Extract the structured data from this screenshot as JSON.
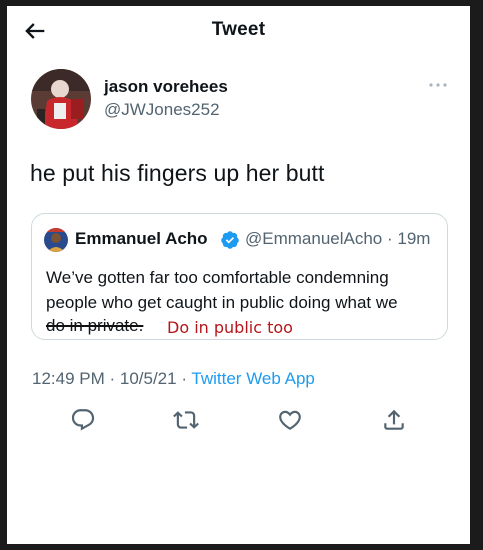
{
  "header": {
    "title": "Tweet",
    "back_icon": "arrow-left-icon"
  },
  "tweet": {
    "author_name": "jason vorehees",
    "author_handle": "@JWJones252",
    "text": "he put his fingers up her butt",
    "timestamp": "12:49 PM · 10/5/21 · ",
    "source": "Twitter Web App"
  },
  "quoted_tweet": {
    "author_name": "Emmanuel Acho",
    "author_handle": "@EmmanuelAcho · 19m",
    "line1": "We’ve gotten far too comfortable condemning",
    "line2": "people who get caught in public doing what we",
    "line3_struck": "do in private.",
    "verified": true
  },
  "annotation": {
    "text": "Do in public too",
    "color": "#b5161b"
  },
  "actions": [
    {
      "icon": "reply-icon"
    },
    {
      "icon": "retweet-icon"
    },
    {
      "icon": "like-icon"
    },
    {
      "icon": "share-icon"
    }
  ],
  "colors": {
    "text_primary": "#0f1419",
    "text_secondary": "#536471",
    "accent": "#1d9bf0",
    "border": "#cfd9de"
  }
}
